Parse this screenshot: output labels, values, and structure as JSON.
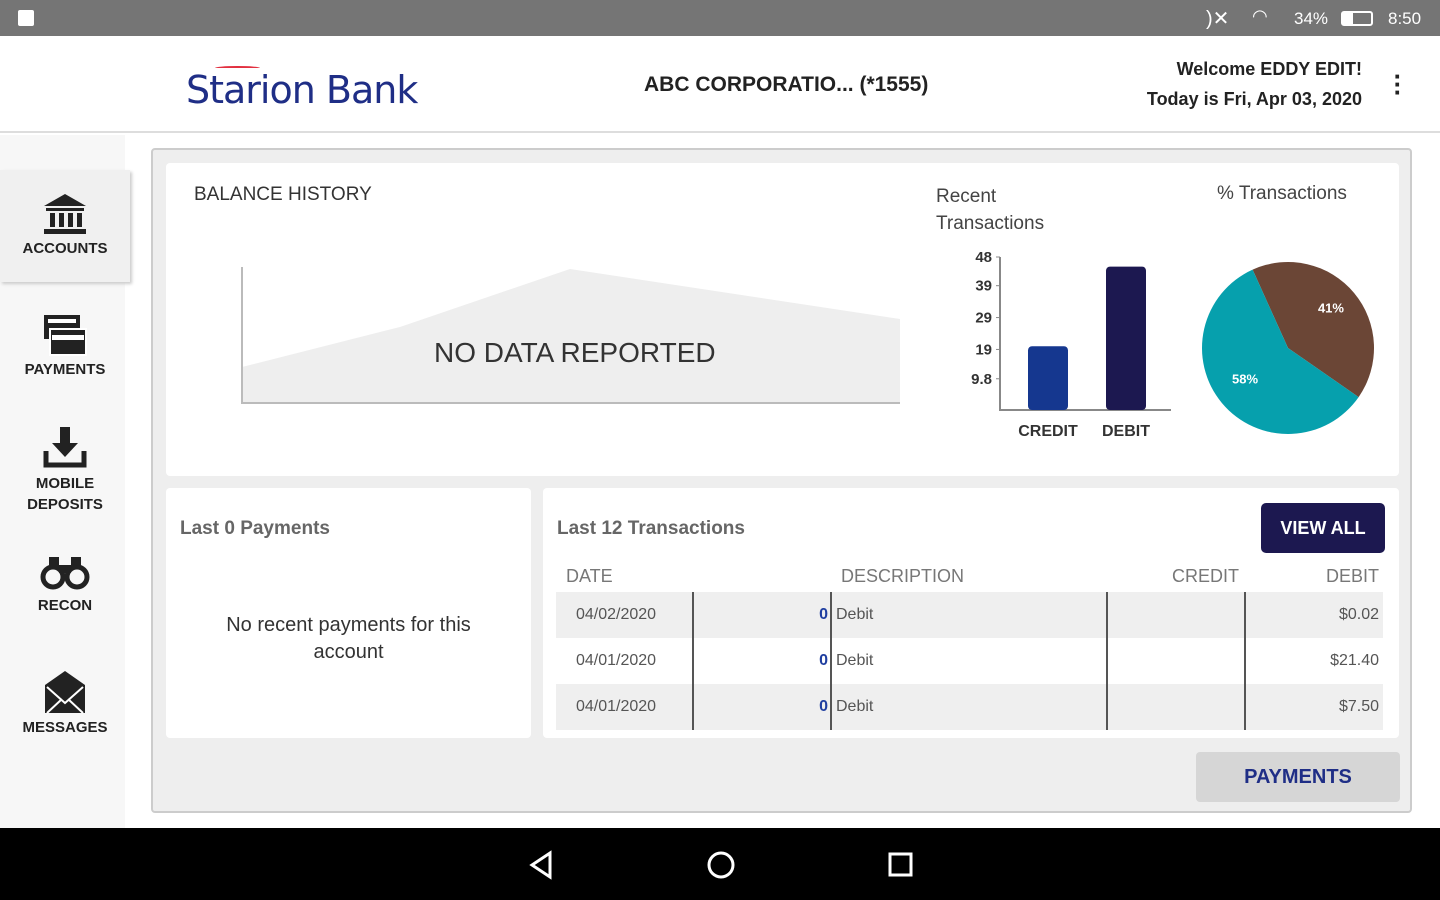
{
  "status_bar": {
    "battery": "34%",
    "time": "8:50"
  },
  "header": {
    "logo": "Starion Bank",
    "account": "ABC CORPORATIO... (*1555)",
    "welcome": "Welcome EDDY EDIT!",
    "date": "Today is Fri, Apr 03, 2020"
  },
  "sidebar": {
    "items": [
      {
        "label": "ACCOUNTS"
      },
      {
        "label": "PAYMENTS"
      },
      {
        "label": "MOBILE DEPOSITS"
      },
      {
        "label": "RECON"
      },
      {
        "label": "MESSAGES"
      }
    ]
  },
  "balance": {
    "title": "BALANCE HISTORY",
    "empty": "NO DATA REPORTED"
  },
  "chart_data": [
    {
      "type": "bar",
      "title": "Recent Transactions",
      "categories": [
        "CREDIT",
        "DEBIT"
      ],
      "values": [
        20,
        45
      ],
      "yticks": [
        "9.8",
        "19",
        "29",
        "39",
        "48"
      ],
      "ylim": [
        0,
        48
      ],
      "colors": [
        "#15378f",
        "#1c1850"
      ]
    },
    {
      "type": "pie",
      "title": "% Transactions",
      "slices": [
        {
          "label": "41%",
          "value": 41,
          "color": "#6b4636"
        },
        {
          "label": "58%",
          "value": 58,
          "color": "#06a0ad"
        }
      ]
    }
  ],
  "payments_card": {
    "title": "Last 0 Payments",
    "empty": "No recent payments for this account"
  },
  "transactions": {
    "title": "Last 12 Transactions",
    "view_all": "VIEW ALL",
    "columns": [
      "DATE",
      "DESCRIPTION",
      "CREDIT",
      "DEBIT"
    ],
    "rows": [
      {
        "date": "04/02/2020",
        "num": "0",
        "desc": "Debit",
        "credit": "",
        "debit": "$0.02"
      },
      {
        "date": "04/01/2020",
        "num": "0",
        "desc": "Debit",
        "credit": "",
        "debit": "$21.40"
      },
      {
        "date": "04/01/2020",
        "num": "0",
        "desc": "Debit",
        "credit": "",
        "debit": "$7.50"
      }
    ]
  },
  "payments_button": "PAYMENTS"
}
